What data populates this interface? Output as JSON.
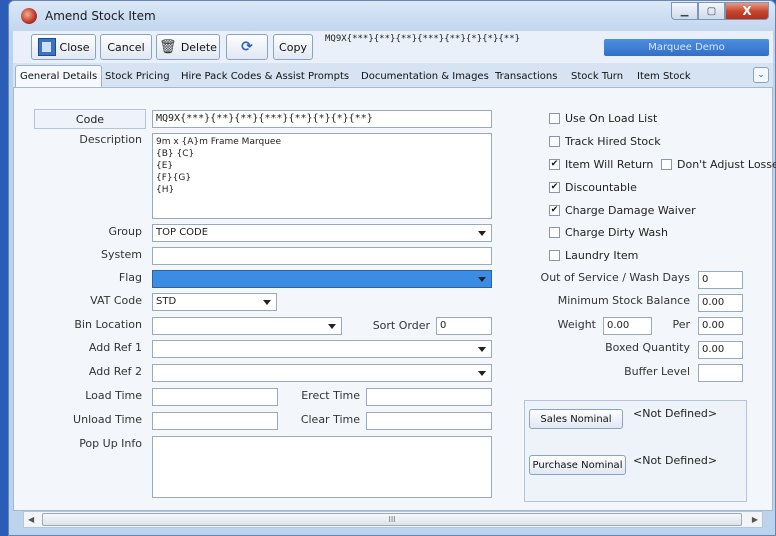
{
  "window": {
    "title": "Amend Stock Item",
    "min_label": "▁",
    "max_label": "▢",
    "close_label": "X"
  },
  "toolbar": {
    "close_label": "Close",
    "cancel_label": "Cancel",
    "delete_label": "Delete",
    "refresh_label": "⟳",
    "copy_label": "Copy",
    "code_display": "MQ9X{***}{**}{**}{***}{**}{*}{*}{**}",
    "company_badge": "Marquee Demo"
  },
  "tabs": [
    {
      "label": "General Details",
      "active": true
    },
    {
      "label": "Stock Pricing",
      "active": false
    },
    {
      "label": "Hire Pack Codes & Assist Prompts",
      "active": false
    },
    {
      "label": "Documentation & Images",
      "active": false
    },
    {
      "label": "Transactions",
      "active": false
    },
    {
      "label": "Stock Turn",
      "active": false
    },
    {
      "label": "Item Stock",
      "active": false
    }
  ],
  "tab_more_icon": "chevron-down-icon",
  "form": {
    "code_label": "Code",
    "code_value": "MQ9X{***}{**}{**}{***}{**}{*}{*}{**}",
    "description_label": "Description",
    "description_value": "9m x {A}m Frame Marquee\n{B} {C}\n{E}\n{F}{G}\n{H}",
    "group_label": "Group",
    "group_value": "TOP CODE",
    "system_label": "System",
    "system_value": "",
    "flag_label": "Flag",
    "flag_value": "",
    "vat_code_label": "VAT Code",
    "vat_code_value": "STD",
    "bin_location_label": "Bin Location",
    "bin_location_value": "",
    "sort_order_label": "Sort Order",
    "sort_order_value": "0",
    "add_ref1_label": "Add Ref 1",
    "add_ref1_value": "",
    "add_ref2_label": "Add Ref 2",
    "add_ref2_value": "",
    "load_time_label": "Load Time",
    "load_time_value": "",
    "erect_time_label": "Erect Time",
    "erect_time_value": "",
    "unload_time_label": "Unload Time",
    "unload_time_value": "",
    "clear_time_label": "Clear Time",
    "clear_time_value": "",
    "popup_info_label": "Pop Up Info",
    "popup_info_value": ""
  },
  "options": {
    "use_on_load_list": {
      "label": "Use On Load List",
      "checked": false
    },
    "track_hired_stock": {
      "label": "Track Hired Stock",
      "checked": false
    },
    "item_will_return": {
      "label": "Item Will Return",
      "checked": true
    },
    "dont_adjust_losses": {
      "label": "Don't Adjust Losse",
      "checked": false
    },
    "discountable": {
      "label": "Discountable",
      "checked": true
    },
    "charge_damage_waiver": {
      "label": "Charge Damage Waiver",
      "checked": true
    },
    "charge_dirty_wash": {
      "label": "Charge Dirty Wash",
      "checked": false
    },
    "laundry_item": {
      "label": "Laundry Item",
      "checked": false
    }
  },
  "stock": {
    "out_of_service_label": "Out of Service / Wash Days",
    "out_of_service_value": "0",
    "min_stock_label": "Minimum Stock Balance",
    "min_stock_value": "0.00",
    "weight_label": "Weight",
    "weight_value": "0.00",
    "per_label": "Per",
    "per_value": "0.00",
    "boxed_qty_label": "Boxed Quantity",
    "boxed_qty_value": "0.00",
    "buffer_level_label": "Buffer Level",
    "buffer_level_value": ""
  },
  "nominals": {
    "sales_button": "Sales Nominal",
    "sales_value": "<Not Defined>",
    "purchase_button": "Purchase Nominal",
    "purchase_value": "<Not Defined>"
  },
  "scrollbar": {
    "left_arrow": "◀",
    "right_arrow": "▶",
    "grip": "III"
  }
}
